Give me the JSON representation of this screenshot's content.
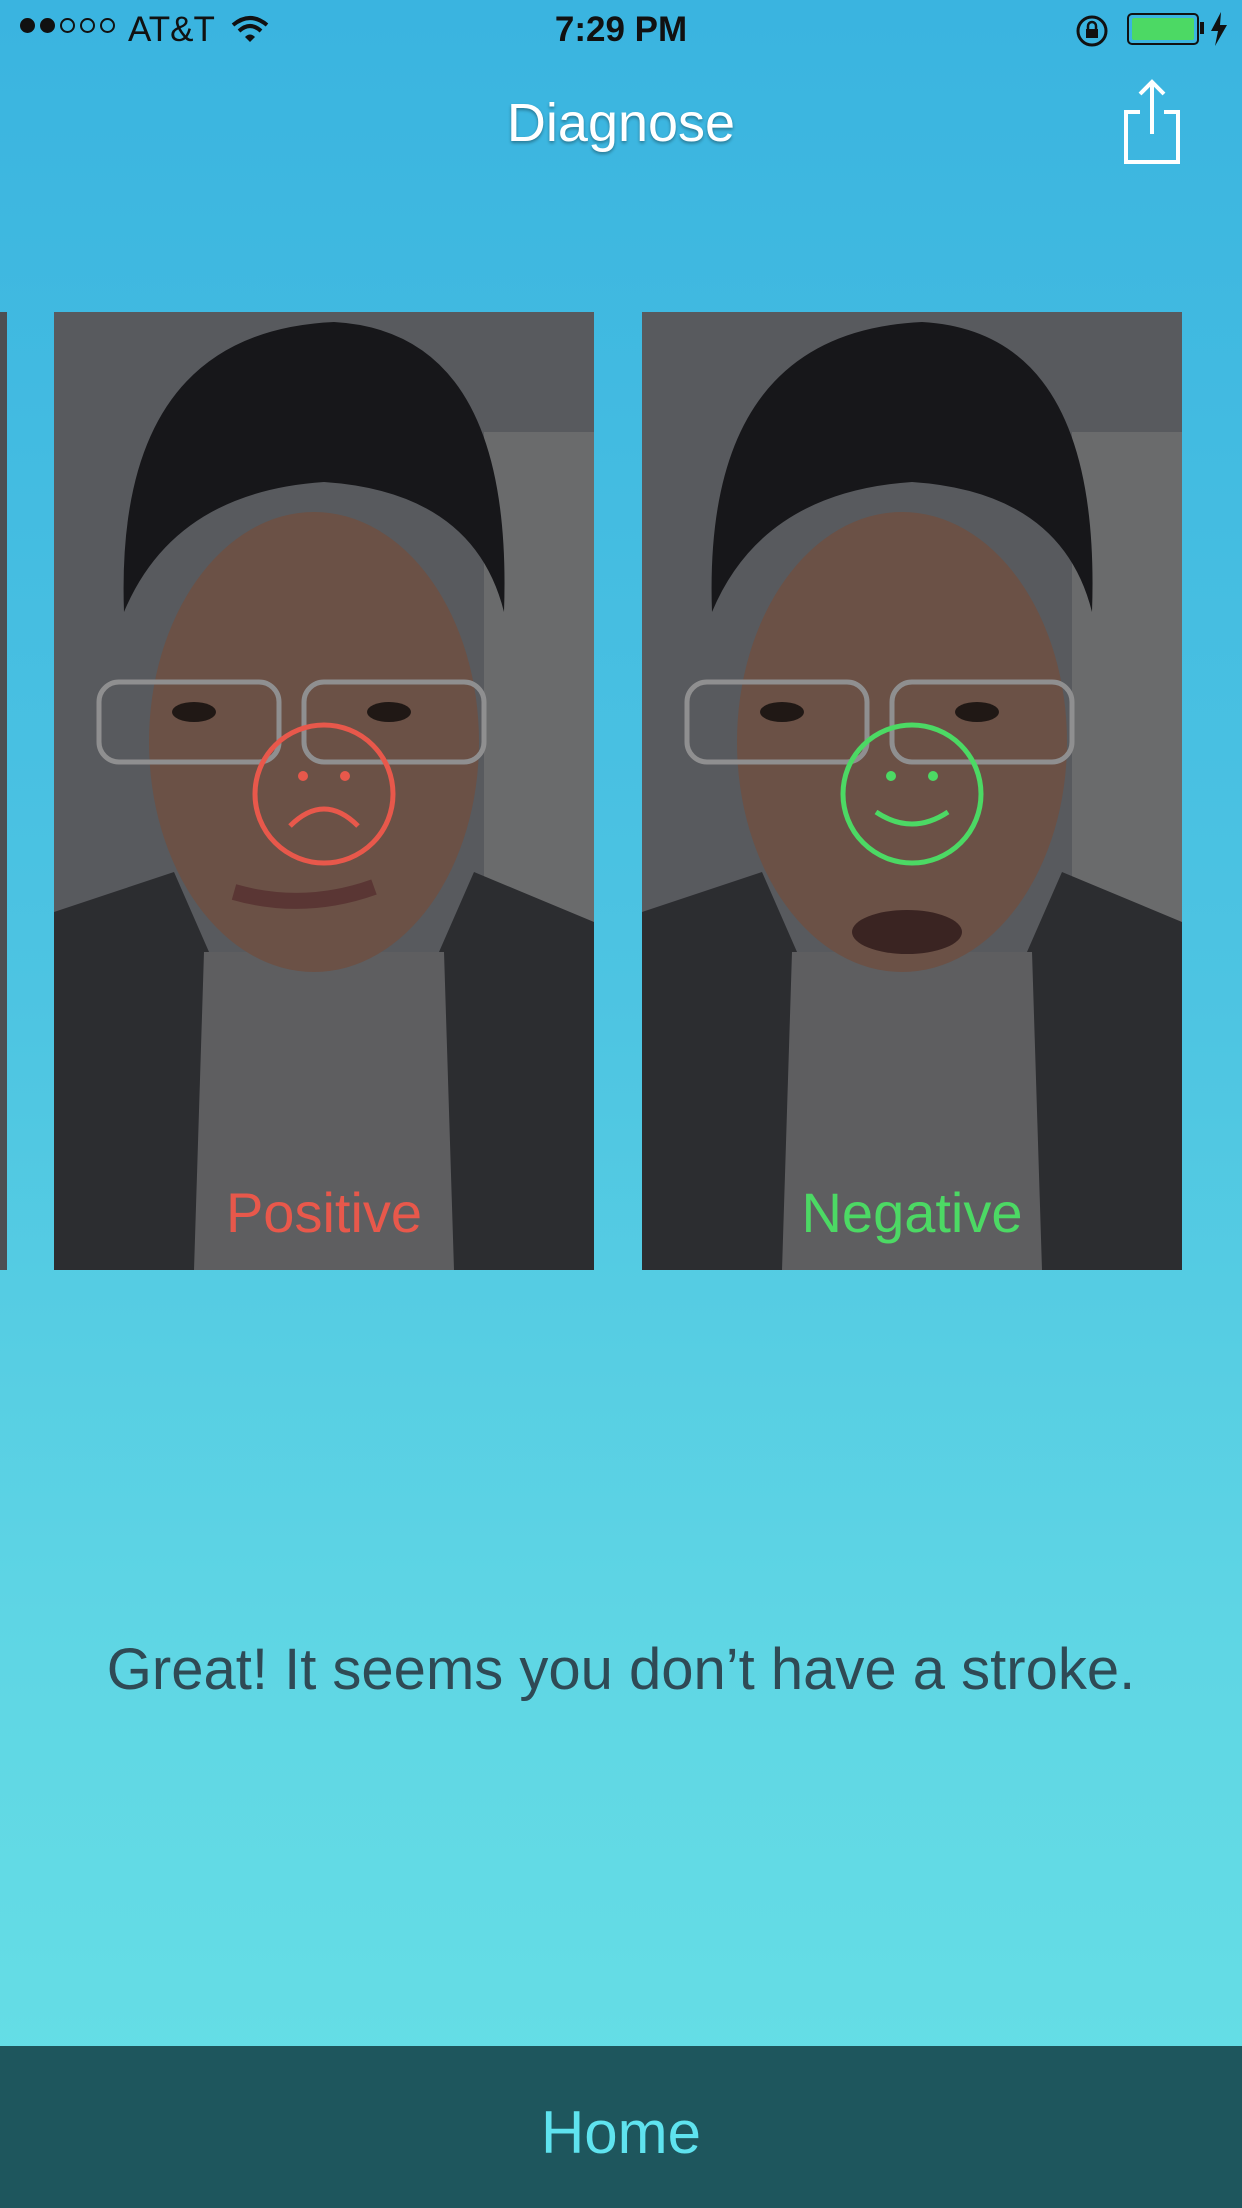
{
  "status_bar": {
    "signal_dots_filled": 2,
    "signal_dots_total": 5,
    "carrier": "AT&T",
    "time": "7:29 PM",
    "battery_color": "#4cd964"
  },
  "header": {
    "title": "Diagnose",
    "share_icon": "share-icon"
  },
  "cards": [
    {
      "label": "Positive",
      "face": "sad-face-icon",
      "color": "#e8584b"
    },
    {
      "label": "Negative",
      "face": "smiley-face-icon",
      "color": "#4cd964"
    }
  ],
  "result_message": "Great! It seems you don’t have a stroke.",
  "footer": {
    "home_label": "Home"
  },
  "colors": {
    "background_top": "#3ab4e0",
    "background_bottom": "#67e0e6",
    "footer_bg": "#1e565d",
    "footer_text": "#5fe3ef"
  }
}
